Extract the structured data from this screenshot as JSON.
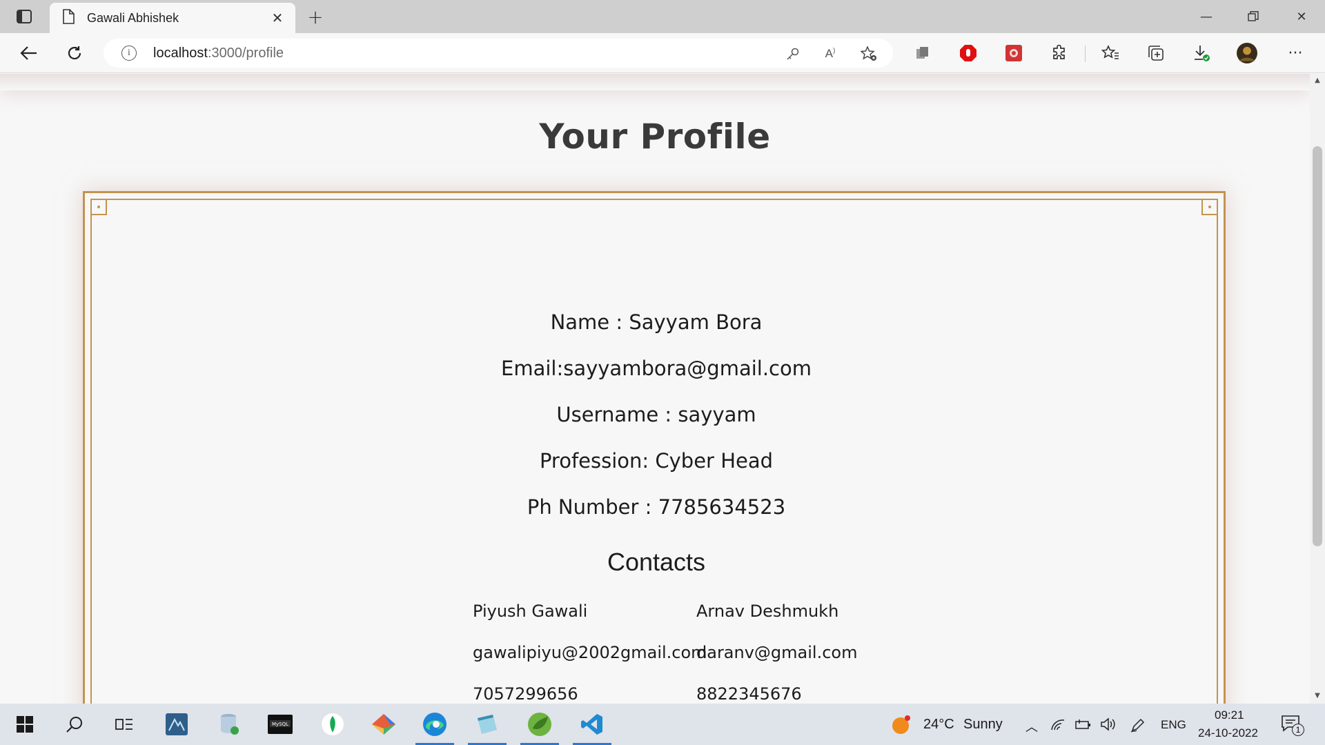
{
  "browser": {
    "tab_title": "Gawali Abhishek",
    "url_host": "localhost",
    "url_path": ":3000/profile",
    "icons": [
      "tab-actions-icon",
      "page-icon",
      "close-icon",
      "plus-icon",
      "minimize-icon",
      "restore-icon",
      "close-window-icon",
      "back-icon",
      "reload-icon",
      "info-icon",
      "key-icon",
      "read-aloud-icon",
      "add-favorite-icon",
      "extensions-icon",
      "favorites-icon",
      "collections-icon",
      "downloads-icon",
      "profile-avatar",
      "more-icon"
    ]
  },
  "page": {
    "heading": "Your Profile",
    "name_line": "Name : Sayyam Bora",
    "email_line": "Email:sayyambora@gmail.com",
    "username_line": "Username : sayyam",
    "profession_line": "Profession: Cyber Head",
    "phone_line": "Ph Number : 7785634523",
    "contacts_title": "Contacts",
    "contacts": [
      {
        "name": "Piyush Gawali",
        "email": "gawalipiyu@2002gmail.com",
        "phone": "7057299656"
      },
      {
        "name": "Arnav Deshmukh",
        "email": "daranv@gmail.com",
        "phone": "8822345676"
      }
    ],
    "accent_color": "#c4924f"
  },
  "taskbar": {
    "weather_temp": "24°C",
    "weather_text": "Sunny",
    "language": "ENG",
    "time": "09:21",
    "date": "24-10-2022",
    "notification_count": "1"
  }
}
